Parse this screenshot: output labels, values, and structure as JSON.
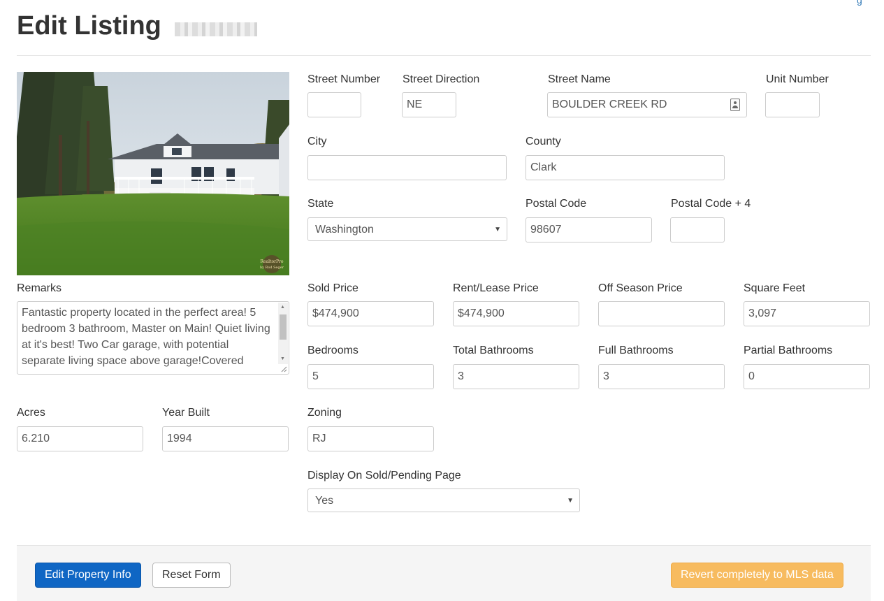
{
  "page": {
    "title": "Edit Listing",
    "corner_link": "g"
  },
  "colors": {
    "primary": "#0f66c4",
    "warning": "#f7bb5f",
    "link": "#337ab7"
  },
  "fields": {
    "street_number": {
      "label": "Street Number",
      "value": ""
    },
    "street_direction": {
      "label": "Street Direction",
      "value": "NE"
    },
    "street_name": {
      "label": "Street Name",
      "value": "BOULDER CREEK RD"
    },
    "unit_number": {
      "label": "Unit Number",
      "value": ""
    },
    "city": {
      "label": "City",
      "value": ""
    },
    "county": {
      "label": "County",
      "value": "Clark"
    },
    "state": {
      "label": "State",
      "value": "Washington"
    },
    "postal_code": {
      "label": "Postal Code",
      "value": "98607"
    },
    "postal_code_4": {
      "label": "Postal Code + 4",
      "value": ""
    },
    "remarks": {
      "label": "Remarks",
      "value": "Fantastic property located in the perfect area! 5 bedroom 3 bathroom, Master on Main! Quiet living at it's best! Two Car garage, with potential separate living space above garage!Covered"
    },
    "sold_price": {
      "label": "Sold Price",
      "value": "$474,900"
    },
    "rent_lease_price": {
      "label": "Rent/Lease Price",
      "value": "$474,900"
    },
    "off_season_price": {
      "label": "Off Season Price",
      "value": ""
    },
    "square_feet": {
      "label": "Square Feet",
      "value": "3,097"
    },
    "bedrooms": {
      "label": "Bedrooms",
      "value": "5"
    },
    "total_bathrooms": {
      "label": "Total Bathrooms",
      "value": "3"
    },
    "full_bathrooms": {
      "label": "Full Bathrooms",
      "value": "3"
    },
    "partial_bathrooms": {
      "label": "Partial Bathrooms",
      "value": "0"
    },
    "acres": {
      "label": "Acres",
      "value": "6.210"
    },
    "year_built": {
      "label": "Year Built",
      "value": "1994"
    },
    "zoning": {
      "label": "Zoning",
      "value": "RJ"
    },
    "display_on_sold": {
      "label": "Display On Sold/Pending Page",
      "value": "Yes"
    }
  },
  "photo": {
    "watermark_line1": "RealtorPro",
    "watermark_line2": "by Rod Seger"
  },
  "buttons": {
    "edit_property": "Edit Property Info",
    "reset_form": "Reset Form",
    "revert_mls": "Revert completely to MLS data"
  }
}
